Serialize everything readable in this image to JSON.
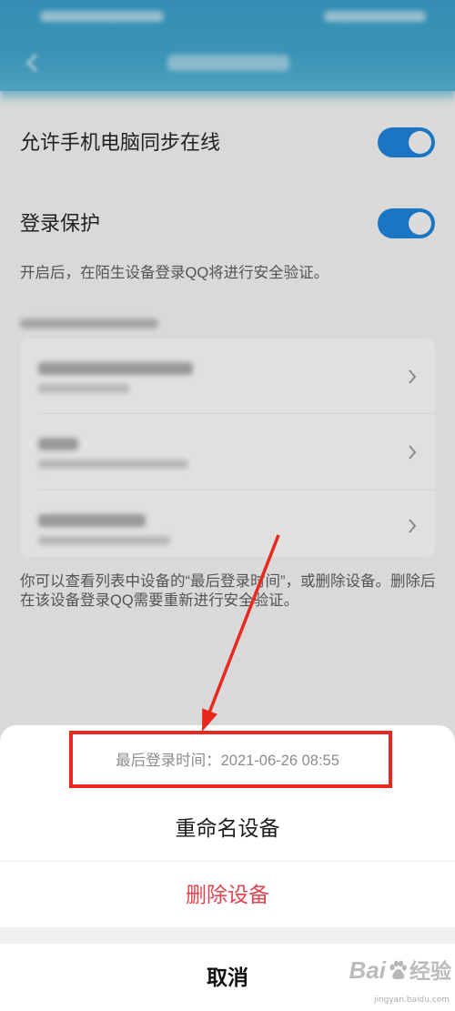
{
  "header": {
    "back_icon": "back-arrow-icon"
  },
  "settings": {
    "sync_online": {
      "label": "允许手机电脑同步在线",
      "enabled": true
    },
    "login_protection": {
      "label": "登录保护",
      "enabled": true,
      "description": "开启后，在陌生设备登录QQ将进行安全验证。"
    }
  },
  "device_list": {
    "chevron_icon": "chevron-right-icon"
  },
  "footer_note": "你可以查看列表中设备的“最后登录时间”，或删除设备。删除后在该设备登录QQ需要重新进行安全验证。",
  "action_sheet": {
    "last_login_label": "最后登录时间：",
    "last_login_time": "2021-06-26 08:55",
    "rename_label": "重命名设备",
    "delete_label": "删除设备",
    "cancel_label": "取消"
  },
  "watermark": {
    "brand_left": "Bai",
    "brand_icon": "paw-icon",
    "brand_right": "经验",
    "url": "jingyan.baidu.com"
  },
  "colors": {
    "accent": "#1d84d8",
    "danger": "#e0454f",
    "header": "#42a5cb",
    "annotation": "#e8271f",
    "page_bg": "#f2f2f2"
  }
}
